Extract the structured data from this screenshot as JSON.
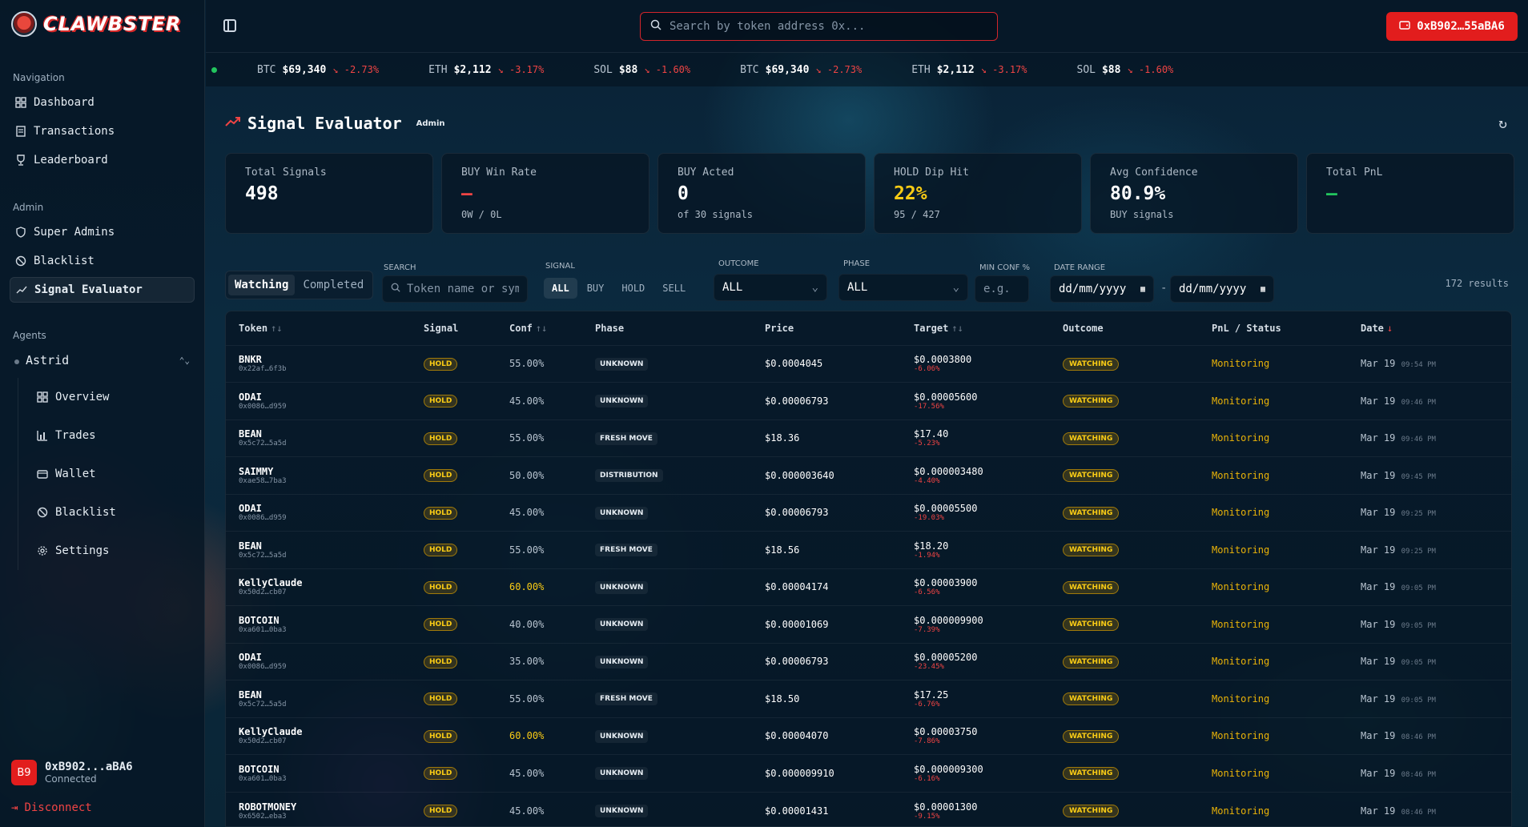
{
  "app": {
    "name": "CLAWBSTER"
  },
  "sidebar": {
    "navigation_title": "Navigation",
    "nav": [
      {
        "label": "Dashboard",
        "icon": "grid-icon"
      },
      {
        "label": "Transactions",
        "icon": "receipt-icon"
      },
      {
        "label": "Leaderboard",
        "icon": "trophy-icon"
      }
    ],
    "admin_title": "Admin",
    "admin": [
      {
        "label": "Super Admins",
        "icon": "shield-icon"
      },
      {
        "label": "Blacklist",
        "icon": "ban-icon"
      },
      {
        "label": "Signal Evaluator",
        "icon": "trend-icon"
      }
    ],
    "agents_title": "Agents",
    "agent_selected": "Astrid",
    "agent_nav": [
      {
        "label": "Overview",
        "icon": "grid-icon"
      },
      {
        "label": "Trades",
        "icon": "bar-chart-icon"
      },
      {
        "label": "Wallet",
        "icon": "wallet-icon"
      },
      {
        "label": "Blacklist",
        "icon": "ban-icon"
      },
      {
        "label": "Settings",
        "icon": "gear-icon"
      }
    ],
    "user": {
      "avatar": "B9",
      "name": "0xB902...aBA6",
      "status": "Connected"
    },
    "disconnect": "Disconnect"
  },
  "header": {
    "search_placeholder": "Search by token address 0x...",
    "wallet": "0xB902…55aBA6"
  },
  "ticker": [
    {
      "sym": "BTC",
      "price": "$69,340",
      "chg": "-2.73%"
    },
    {
      "sym": "ETH",
      "price": "$2,112",
      "chg": "-3.17%"
    },
    {
      "sym": "SOL",
      "price": "$88",
      "chg": "-1.60%"
    },
    {
      "sym": "BTC",
      "price": "$69,340",
      "chg": "-2.73%"
    },
    {
      "sym": "ETH",
      "price": "$2,112",
      "chg": "-3.17%"
    },
    {
      "sym": "SOL",
      "price": "$88",
      "chg": "-1.60%"
    }
  ],
  "page": {
    "title": "Signal Evaluator",
    "badge": "Admin"
  },
  "stats": [
    {
      "label": "Total Signals",
      "value": "498",
      "sub": "",
      "tone": ""
    },
    {
      "label": "BUY Win Rate",
      "value": "—",
      "sub": "0W / 0L",
      "tone": "red"
    },
    {
      "label": "BUY Acted",
      "value": "0",
      "sub": "of 30 signals",
      "tone": ""
    },
    {
      "label": "HOLD Dip Hit",
      "value": "22%",
      "sub": "95 / 427",
      "tone": "yellow"
    },
    {
      "label": "Avg Confidence",
      "value": "80.9%",
      "sub": "BUY signals",
      "tone": ""
    },
    {
      "label": "Total PnL",
      "value": "—",
      "sub": "",
      "tone": "green"
    }
  ],
  "filters": {
    "tabs": [
      "Watching",
      "Completed"
    ],
    "search_label": "SEARCH",
    "search_placeholder": "Token name or symbol",
    "signal_label": "SIGNAL",
    "signals": [
      "ALL",
      "BUY",
      "HOLD",
      "SELL"
    ],
    "outcome_label": "OUTCOME",
    "outcome_value": "ALL",
    "phase_label": "PHASE",
    "phase_value": "ALL",
    "minconf_label": "MIN CONF %",
    "minconf_placeholder": "e.g.",
    "date_label": "DATE RANGE",
    "date_from": "dd/mm/yyyy",
    "date_sep": "-",
    "date_to": "dd/mm/yyyy",
    "results": "172 results"
  },
  "table": {
    "headers": [
      "Token",
      "Signal",
      "Conf",
      "Phase",
      "Price",
      "Target",
      "Outcome",
      "PnL / Status",
      "Date"
    ],
    "rows": [
      {
        "name": "BNKR",
        "addr": "0x22af…6f3b",
        "signal": "HOLD",
        "conf": "55.00%",
        "phase": "UNKNOWN",
        "price": "$0.0004045",
        "target": "$0.0003800",
        "tpct": "-6.06%",
        "outcome": "WATCHING",
        "status": "Monitoring",
        "date": "Mar 19",
        "time": "09:54 PM"
      },
      {
        "name": "ODAI",
        "addr": "0x0086…d959",
        "signal": "HOLD",
        "conf": "45.00%",
        "phase": "UNKNOWN",
        "price": "$0.00006793",
        "target": "$0.00005600",
        "tpct": "-17.56%",
        "outcome": "WATCHING",
        "status": "Monitoring",
        "date": "Mar 19",
        "time": "09:46 PM"
      },
      {
        "name": "BEAN",
        "addr": "0x5c72…5a5d",
        "signal": "HOLD",
        "conf": "55.00%",
        "phase": "FRESH MOVE",
        "price": "$18.36",
        "target": "$17.40",
        "tpct": "-5.23%",
        "outcome": "WATCHING",
        "status": "Monitoring",
        "date": "Mar 19",
        "time": "09:46 PM"
      },
      {
        "name": "SAIMMY",
        "addr": "0xae58…7ba3",
        "signal": "HOLD",
        "conf": "50.00%",
        "phase": "DISTRIBUTION",
        "price": "$0.000003640",
        "target": "$0.000003480",
        "tpct": "-4.40%",
        "outcome": "WATCHING",
        "status": "Monitoring",
        "date": "Mar 19",
        "time": "09:45 PM"
      },
      {
        "name": "ODAI",
        "addr": "0x0086…d959",
        "signal": "HOLD",
        "conf": "45.00%",
        "phase": "UNKNOWN",
        "price": "$0.00006793",
        "target": "$0.00005500",
        "tpct": "-19.03%",
        "outcome": "WATCHING",
        "status": "Monitoring",
        "date": "Mar 19",
        "time": "09:25 PM"
      },
      {
        "name": "BEAN",
        "addr": "0x5c72…5a5d",
        "signal": "HOLD",
        "conf": "55.00%",
        "phase": "FRESH MOVE",
        "price": "$18.56",
        "target": "$18.20",
        "tpct": "-1.94%",
        "outcome": "WATCHING",
        "status": "Monitoring",
        "date": "Mar 19",
        "time": "09:25 PM"
      },
      {
        "name": "KellyClaude",
        "addr": "0x50d2…cb07",
        "signal": "HOLD",
        "conf": "60.00%",
        "phase": "UNKNOWN",
        "price": "$0.00004174",
        "target": "$0.00003900",
        "tpct": "-6.56%",
        "outcome": "WATCHING",
        "status": "Monitoring",
        "date": "Mar 19",
        "time": "09:05 PM"
      },
      {
        "name": "BOTCOIN",
        "addr": "0xa601…0ba3",
        "signal": "HOLD",
        "conf": "40.00%",
        "phase": "UNKNOWN",
        "price": "$0.00001069",
        "target": "$0.000009900",
        "tpct": "-7.39%",
        "outcome": "WATCHING",
        "status": "Monitoring",
        "date": "Mar 19",
        "time": "09:05 PM"
      },
      {
        "name": "ODAI",
        "addr": "0x0086…d959",
        "signal": "HOLD",
        "conf": "35.00%",
        "phase": "UNKNOWN",
        "price": "$0.00006793",
        "target": "$0.00005200",
        "tpct": "-23.45%",
        "outcome": "WATCHING",
        "status": "Monitoring",
        "date": "Mar 19",
        "time": "09:05 PM"
      },
      {
        "name": "BEAN",
        "addr": "0x5c72…5a5d",
        "signal": "HOLD",
        "conf": "55.00%",
        "phase": "FRESH MOVE",
        "price": "$18.50",
        "target": "$17.25",
        "tpct": "-6.76%",
        "outcome": "WATCHING",
        "status": "Monitoring",
        "date": "Mar 19",
        "time": "09:05 PM"
      },
      {
        "name": "KellyClaude",
        "addr": "0x50d2…cb07",
        "signal": "HOLD",
        "conf": "60.00%",
        "phase": "UNKNOWN",
        "price": "$0.00004070",
        "target": "$0.00003750",
        "tpct": "-7.86%",
        "outcome": "WATCHING",
        "status": "Monitoring",
        "date": "Mar 19",
        "time": "08:46 PM"
      },
      {
        "name": "BOTCOIN",
        "addr": "0xa601…0ba3",
        "signal": "HOLD",
        "conf": "45.00%",
        "phase": "UNKNOWN",
        "price": "$0.000009910",
        "target": "$0.000009300",
        "tpct": "-6.16%",
        "outcome": "WATCHING",
        "status": "Monitoring",
        "date": "Mar 19",
        "time": "08:46 PM"
      },
      {
        "name": "ROBOTMONEY",
        "addr": "0x6502…eba3",
        "signal": "HOLD",
        "conf": "45.00%",
        "phase": "UNKNOWN",
        "price": "$0.00001431",
        "target": "$0.00001300",
        "tpct": "-9.15%",
        "outcome": "WATCHING",
        "status": "Monitoring",
        "date": "Mar 19",
        "time": "08:46 PM"
      }
    ]
  },
  "colors": {
    "accent": "#e21d1d",
    "warning": "#facc15",
    "positive": "#22c55e",
    "negative": "#ef4444"
  }
}
